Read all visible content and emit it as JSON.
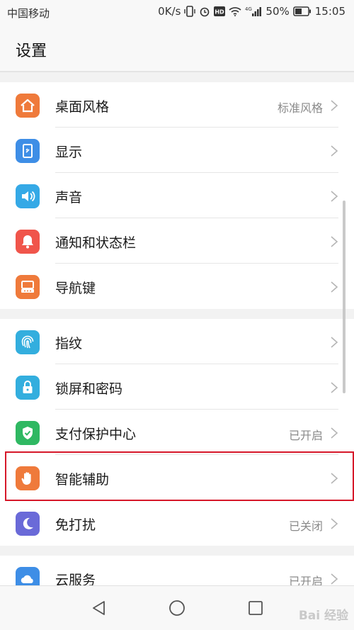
{
  "status_bar": {
    "carrier": "中国移动",
    "speed": "0K/s",
    "network": "4G",
    "battery": "50%",
    "time": "15:05"
  },
  "header": {
    "title": "设置"
  },
  "groups": [
    {
      "items": [
        {
          "label": "桌面风格",
          "value": "标准风格",
          "icon": "home-icon",
          "color": "#ef7a3b"
        },
        {
          "label": "显示",
          "value": "",
          "icon": "display-icon",
          "color": "#3e8ee6"
        },
        {
          "label": "声音",
          "value": "",
          "icon": "speaker-icon",
          "color": "#35a9e6"
        },
        {
          "label": "通知和状态栏",
          "value": "",
          "icon": "bell-icon",
          "color": "#f0554b"
        },
        {
          "label": "导航键",
          "value": "",
          "icon": "navigation-key-icon",
          "color": "#ef7a3b"
        }
      ]
    },
    {
      "items": [
        {
          "label": "指纹",
          "value": "",
          "icon": "fingerprint-icon",
          "color": "#33aede"
        },
        {
          "label": "锁屏和密码",
          "value": "",
          "icon": "lock-icon",
          "color": "#33aede"
        },
        {
          "label": "支付保护中心",
          "value": "已开启",
          "icon": "shield-check-icon",
          "color": "#2fb862"
        },
        {
          "label": "智能辅助",
          "value": "",
          "icon": "hand-icon",
          "color": "#ef7a3b"
        },
        {
          "label": "免打扰",
          "value": "已关闭",
          "icon": "moon-icon",
          "color": "#6a6ad8"
        }
      ]
    },
    {
      "items": [
        {
          "label": "云服务",
          "value": "已开启",
          "icon": "cloud-icon",
          "color": "#3e8ee6"
        }
      ]
    }
  ],
  "watermark": "Bai 经验"
}
